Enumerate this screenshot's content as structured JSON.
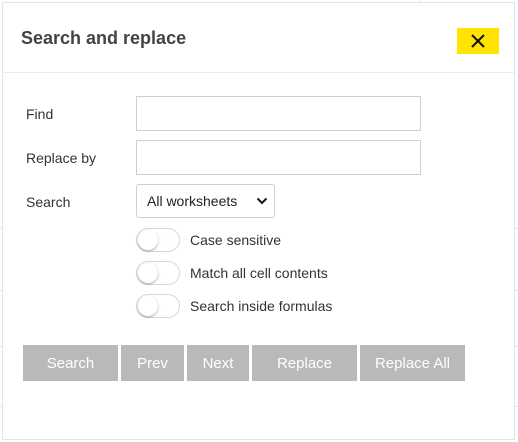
{
  "dialog": {
    "title": "Search and replace",
    "close_icon": "close-icon",
    "accent_color": "#ffe400"
  },
  "form": {
    "find": {
      "label": "Find",
      "value": "",
      "placeholder": ""
    },
    "replace": {
      "label": "Replace by",
      "value": "",
      "placeholder": ""
    },
    "search": {
      "label": "Search",
      "selected": "All worksheets"
    }
  },
  "options": [
    {
      "label": "Case sensitive",
      "checked": false
    },
    {
      "label": "Match all cell contents",
      "checked": false
    },
    {
      "label": "Search inside formulas",
      "checked": false
    }
  ],
  "buttons": {
    "search": "Search",
    "prev": "Prev",
    "next": "Next",
    "replace": "Replace",
    "replace_all": "Replace All",
    "color": "#b9b9b9"
  }
}
